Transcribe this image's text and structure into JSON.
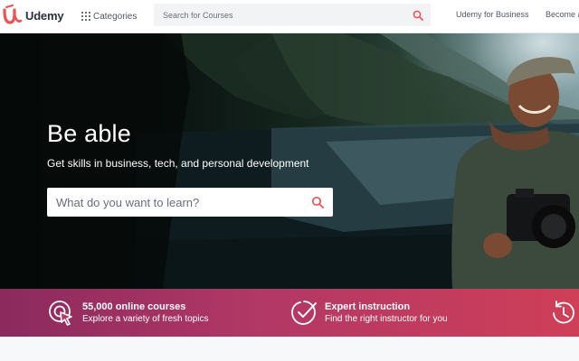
{
  "header": {
    "brand": "Udemy",
    "categories_label": "Categories",
    "search_placeholder": "Search for Courses",
    "nav_business": "Udemy for Business",
    "nav_teacher": "Become a"
  },
  "hero": {
    "title": "Be able",
    "subtitle": "Get skills in business, tech, and personal development",
    "search_placeholder": "What do you want to learn?"
  },
  "features": [
    {
      "icon": "target-cursor-icon",
      "title": "55,000 online courses",
      "desc": "Explore a variety of fresh topics"
    },
    {
      "icon": "checkmark-badge-icon",
      "title": "Expert instruction",
      "desc": "Find the right instructor for you"
    },
    {
      "icon": "history-clock-icon",
      "title": "",
      "desc": ""
    }
  ],
  "colors": {
    "brand_red": "#ec5252",
    "band_start": "#8b2a5e",
    "band_end": "#cf3f58",
    "text_dark": "#29303b"
  }
}
